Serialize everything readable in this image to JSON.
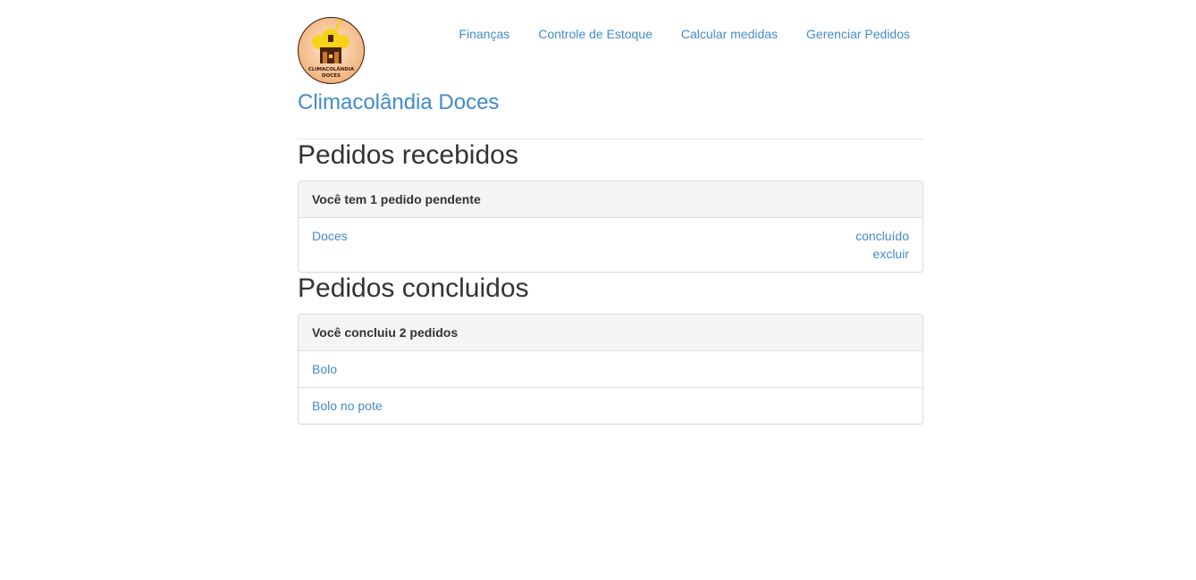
{
  "brand": {
    "name": "Climacolândia Doces",
    "logo_text_line1": "CLIMACOLÂNDIA",
    "logo_text_line2": "DOCES"
  },
  "nav": {
    "items": [
      {
        "label": "Finanças"
      },
      {
        "label": "Controle de Estoque"
      },
      {
        "label": "Calcular medidas"
      },
      {
        "label": "Gerenciar Pedidos"
      }
    ]
  },
  "received": {
    "title": "Pedidos recebidos",
    "heading": "Você tem 1 pedido pendente",
    "items": [
      {
        "name": "Doces",
        "done_label": "concluído",
        "delete_label": "excluir"
      }
    ]
  },
  "completed": {
    "title": "Pedidos concluidos",
    "heading": "Você concluiu 2 pedidos",
    "items": [
      {
        "name": "Bolo"
      },
      {
        "name": "Bolo no pote"
      }
    ]
  },
  "colors": {
    "link": "#428bca",
    "text": "#333333",
    "panel_heading_bg": "#f5f5f5",
    "border": "#dddddd",
    "logo_bg": "#f6c89a",
    "logo_house": "#4a2410",
    "logo_cloud": "#f7d21a"
  }
}
